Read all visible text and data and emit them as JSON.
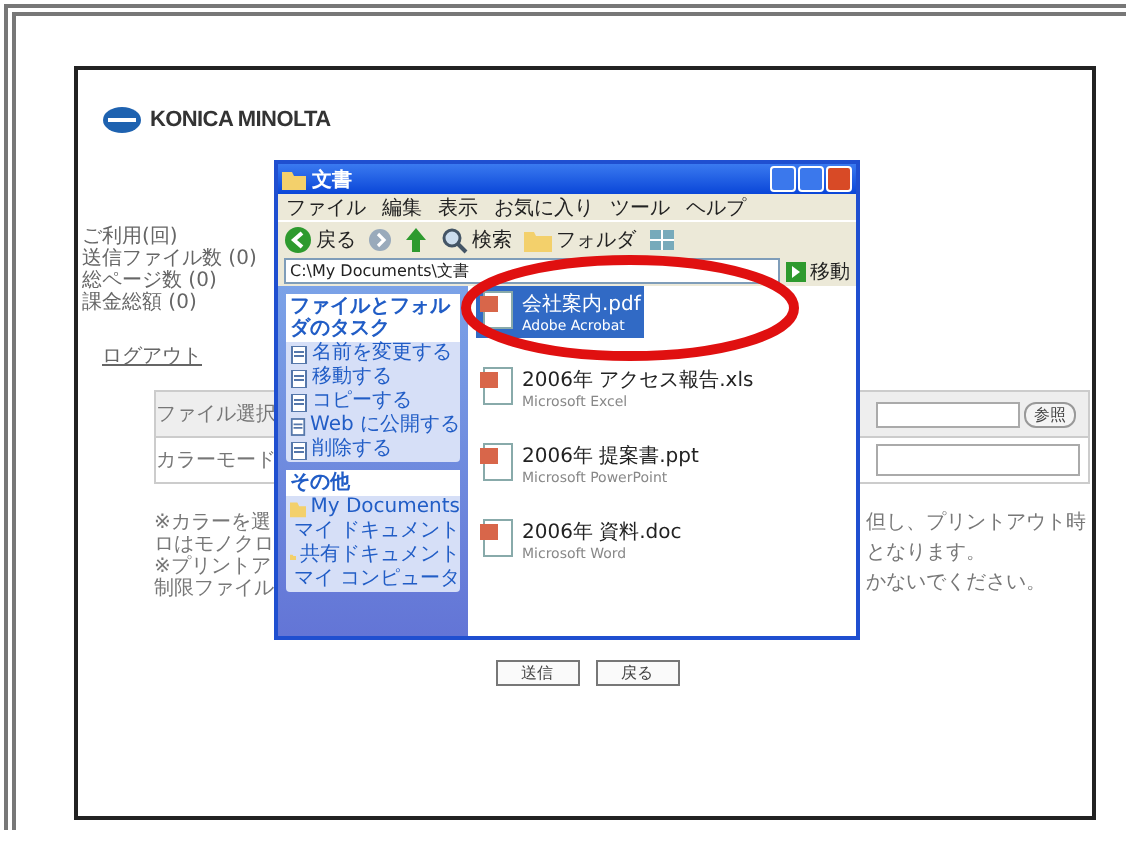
{
  "logo": {
    "text": "KONICA MINOLTA"
  },
  "usage": [
    "ご利用(回)",
    "送信ファイル数 (0)",
    "総ページ数 (0)",
    "課金総額 (0)"
  ],
  "logout": "ログアウト",
  "form": {
    "rows": [
      {
        "label": "ファイル選択",
        "kind": "file",
        "button": "参照"
      },
      {
        "label": "カラーモード",
        "kind": "select"
      }
    ]
  },
  "notes": {
    "left": [
      "※カラーを選",
      "ロはモノクロ",
      "※プリントア",
      "制限ファイル"
    ],
    "right": [
      "但し、プリントアウト時",
      "となります。",
      "かないでください。"
    ]
  },
  "buttons": [
    "送信",
    "戻る"
  ],
  "explorer": {
    "title": "文書",
    "menu": [
      "ファイル",
      "編集",
      "表示",
      "お気に入り",
      "ツール",
      "ヘルプ"
    ],
    "toolbar": [
      {
        "kind": "back",
        "label": "戻る"
      },
      {
        "kind": "forward"
      },
      {
        "kind": "up"
      },
      {
        "kind": "search",
        "label": "検索"
      },
      {
        "kind": "folders",
        "label": "フォルダ"
      },
      {
        "kind": "views"
      }
    ],
    "address": "C:\\My Documents\\文書",
    "go": "移動",
    "sections": [
      {
        "title": "ファイルとフォルダのタスク",
        "items": [
          "名前を変更する",
          "移動する",
          "コピーする",
          "Web に公開する",
          "削除する"
        ]
      },
      {
        "title": "その他",
        "items": [
          "My Documents",
          "マイ ドキュメント",
          "共有ドキュメント",
          "マイ コンピュータ"
        ]
      }
    ],
    "files": [
      {
        "name": "会社案内.pdf",
        "type": "Adobe Acrobat",
        "selected": true
      },
      {
        "name": "2006年 アクセス報告.xls",
        "type": "Microsoft Excel",
        "selected": false
      },
      {
        "name": "2006年 提案書.ppt",
        "type": "Microsoft PowerPoint",
        "selected": false
      },
      {
        "name": "2006年 資料.doc",
        "type": "Microsoft Word",
        "selected": false
      }
    ]
  }
}
